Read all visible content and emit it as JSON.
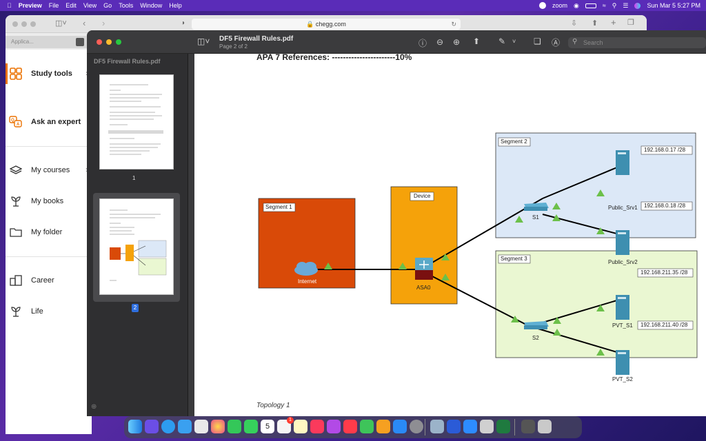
{
  "menubar": {
    "app": "Preview",
    "menus": [
      "File",
      "Edit",
      "View",
      "Go",
      "Tools",
      "Window",
      "Help"
    ],
    "zoom_label": "zoom",
    "datetime": "Sun Mar 5  5:27 PM"
  },
  "browser": {
    "url": "chegg.com",
    "tab_label": "Applica..."
  },
  "chegg_sidebar": {
    "items": [
      {
        "label": "Study tools",
        "icon": "grid-icon"
      },
      {
        "label": "Ask an expert",
        "icon": "qa-icon"
      },
      {
        "label": "My courses",
        "icon": "layers-icon"
      },
      {
        "label": "My books",
        "icon": "plant-icon"
      },
      {
        "label": "My folder",
        "icon": "folder-icon"
      },
      {
        "label": "Career",
        "icon": "career-icon"
      },
      {
        "label": "Life",
        "icon": "plant-icon"
      }
    ]
  },
  "preview": {
    "doc_title": "DF5 Firewall Rules.pdf",
    "page_info": "Page 2 of 2",
    "sidebar_title": "DF5 Firewall Rules.pdf",
    "search_placeholder": "Search",
    "thumbs": [
      {
        "page": "1"
      },
      {
        "page": "2"
      }
    ]
  },
  "document": {
    "header_text": "APA 7 References: -----------------------10%",
    "caption": "Topology 1",
    "topology": {
      "segment1": {
        "label": "Segment 1",
        "node": "Internet"
      },
      "device": {
        "label": "Device",
        "node": "ASA0"
      },
      "segment2": {
        "label": "Segment 2",
        "switch": "S1",
        "servers": [
          {
            "name": "Public_Srv1",
            "ip": "192.168.0.17 /28"
          },
          {
            "name": "Public_Srv2",
            "ip": "192.168.0.18 /28"
          }
        ]
      },
      "segment3": {
        "label": "Segment 3",
        "switch": "S2",
        "servers": [
          {
            "name": "PVT_S1",
            "ip": "192.168.211.35 /28"
          },
          {
            "name": "PVT_S2",
            "ip": "192.168.211.40 /28"
          }
        ]
      }
    }
  },
  "colors": {
    "segment1_fill": "#d94a08",
    "device_fill": "#f5a20a",
    "segment2_fill": "#dce8f7",
    "segment3_fill": "#eaf7d2",
    "link_marker": "#6cc04a",
    "server": "#3e8fb0"
  },
  "dock": {
    "calendar_day": "5",
    "badge_count": "1"
  }
}
